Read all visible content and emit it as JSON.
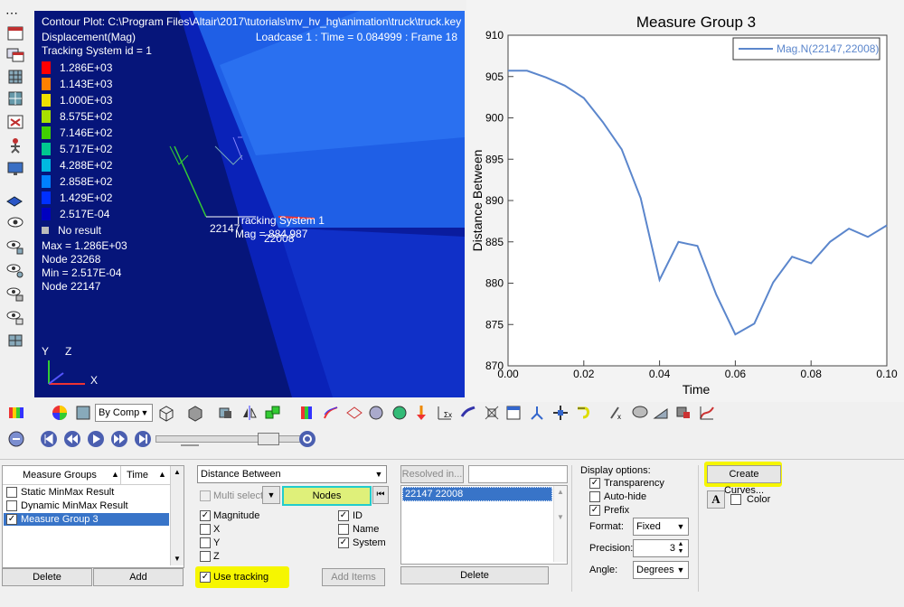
{
  "viewport": {
    "contour_line": "Contour Plot: C:\\Program Files\\Altair\\2017\\tutorials\\mv_hv_hg\\animation\\truck\\truck.key",
    "result_type": "Displacement(Mag)",
    "tracking_system": "Tracking System id = 1",
    "loadcase_line": "Loadcase 1 : Time = 0.084999 : Frame 18",
    "legend": [
      {
        "label": "1.286E+03",
        "color": "#ff0000"
      },
      {
        "label": "1.143E+03",
        "color": "#ff8000"
      },
      {
        "label": "1.000E+03",
        "color": "#f0e000"
      },
      {
        "label": "8.575E+02",
        "color": "#a8e000"
      },
      {
        "label": "7.146E+02",
        "color": "#40d000"
      },
      {
        "label": "5.717E+02",
        "color": "#00c890"
      },
      {
        "label": "4.288E+02",
        "color": "#00b8e0"
      },
      {
        "label": "2.858E+02",
        "color": "#0080ff"
      },
      {
        "label": "1.429E+02",
        "color": "#0030ff"
      },
      {
        "label": "2.517E-04",
        "color": "#0000c0"
      }
    ],
    "no_result": "No result",
    "max_line": "Max = 1.286E+03",
    "max_node": "Node 23268",
    "min_line": "Min = 2.517E-04",
    "min_node": "Node 22147",
    "node_label_1": "22147",
    "node_label_2": "22008",
    "tracking_label": "Tracking System 1",
    "mag_label": "Mag = 884.987",
    "axis_y": "Y",
    "axis_z": "Z",
    "axis_x": "X"
  },
  "chart_data": {
    "type": "line",
    "title": "Measure Group 3",
    "xlabel": "Time",
    "ylabel": "Distance Between",
    "xlim": [
      0.0,
      0.1
    ],
    "ylim": [
      870,
      910
    ],
    "x_ticks": [
      "0.00",
      "0.02",
      "0.04",
      "0.06",
      "0.08",
      "0.10"
    ],
    "y_ticks": [
      "870",
      "875",
      "880",
      "885",
      "890",
      "895",
      "900",
      "905",
      "910"
    ],
    "legend_position": "top-right",
    "series": [
      {
        "name": "Mag.N(22147,22008)",
        "color": "#5b86cc",
        "x": [
          0.0,
          0.005,
          0.01,
          0.015,
          0.02,
          0.025,
          0.03,
          0.035,
          0.04,
          0.045,
          0.05,
          0.055,
          0.06,
          0.065,
          0.07,
          0.075,
          0.08,
          0.085,
          0.09,
          0.095,
          0.1
        ],
        "y": [
          905.7,
          905.7,
          904.9,
          903.9,
          902.4,
          899.5,
          896.2,
          890.3,
          880.4,
          885.0,
          884.5,
          878.6,
          873.8,
          875.1,
          880.1,
          883.2,
          882.4,
          885.0,
          886.6,
          885.6,
          887.0
        ]
      }
    ]
  },
  "toolbar1": {
    "color_mode": "By Comp"
  },
  "panel": {
    "measure_groups_header": "Measure Groups",
    "time_header": "Time",
    "groups": [
      {
        "label": "Static MinMax Result",
        "checked": false,
        "selected": false
      },
      {
        "label": "Dynamic MinMax Result",
        "checked": false,
        "selected": false
      },
      {
        "label": "Measure Group 3",
        "checked": true,
        "selected": true
      }
    ],
    "delete_label": "Delete",
    "add_label": "Add",
    "measure_type": "Distance Between",
    "multi_select": "Multi select",
    "nodes_label": "Nodes",
    "magnitude": "Magnitude",
    "x": "X",
    "y": "Y",
    "z": "Z",
    "id": "ID",
    "name": "Name",
    "system": "System",
    "use_tracking": "Use tracking",
    "add_items": "Add Items",
    "resolved_in": "Resolved in...",
    "node_pair": "22147 22008",
    "delete2": "Delete",
    "display_options": "Display options:",
    "transparency": "Transparency",
    "auto_hide": "Auto-hide",
    "prefix": "Prefix",
    "format_label": "Format:",
    "format_value": "Fixed",
    "precision_label": "Precision:",
    "precision_value": "3",
    "angle_label": "Angle:",
    "angle_value": "Degrees",
    "create_curves": "Create Curves...",
    "font_glyph": "A",
    "color_label": "Color"
  }
}
